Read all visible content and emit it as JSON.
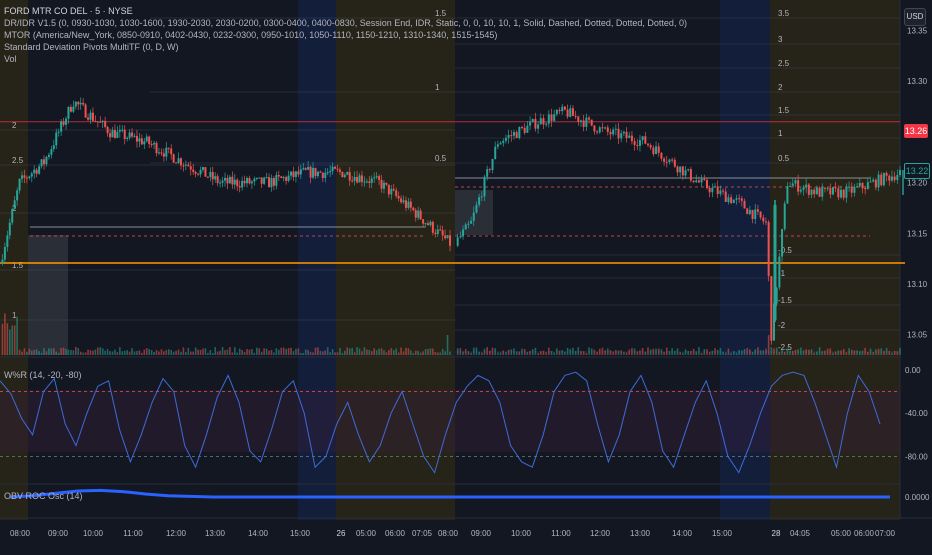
{
  "header": {
    "symbol": "FORD MTR CO DEL · 5 · NYSE",
    "indicators": [
      "DR/IDR V1.5 (0, 0930-1030, 1030-1600, 1930-2030, 2030-0200, 0300-0400, 0400-0830, Session End, IDR, Static, 0, 0, 10, 10, 1, Solid, Dashed, Dotted, Dotted, Dotted, 0)",
      "MTOR (America/New_York, 0850-0910, 0402-0430, 0232-0300, 0950-1010, 1050-1110, 1150-1210, 1310-1340, 1515-1545)",
      "Standard Deviation Pivots MultiTF (0, D, W)",
      "Vol"
    ],
    "currency": "USD"
  },
  "colors": {
    "background": "#131722",
    "up": "#26a69a",
    "down": "#ef5350",
    "orange_line": "#ff9800",
    "red_level": "#f23645",
    "wr_line": "#3f6bd8",
    "obv_line": "#2962ff"
  },
  "chart_data": [
    {
      "type": "candlestick",
      "title": "FORD MTR CO DEL · 5 · NYSE",
      "ylim": [
        13.03,
        13.38
      ],
      "price_ticks": [
        "13.35",
        "13.30",
        "13.25",
        "13.20",
        "13.15",
        "13.10",
        "13.05"
      ],
      "last_price_label": "13.26",
      "current_price_label": "13.22",
      "red_level": 13.26,
      "orange_level": 13.125,
      "std_levels_left": [
        "2",
        "2.5",
        "2",
        "1.5",
        "1"
      ],
      "std_levels_mid": [
        "1.5",
        "1",
        "0.5"
      ],
      "std_levels_right": [
        "3.5",
        "3",
        "2.5",
        "2",
        "1.5",
        "1",
        "0.5",
        "-0.5",
        "-1",
        "-1.5",
        "-2",
        "-2.5"
      ],
      "time_labels": [
        "08:00",
        "09:00",
        "10:00",
        "11:00",
        "12:00",
        "13:00",
        "14:00",
        "15:00",
        "26",
        "05:00",
        "06:00",
        "07:05",
        "08:00",
        "09:00",
        "10:00",
        "11:00",
        "12:00",
        "13:00",
        "14:00",
        "15:00",
        "28",
        "04:05",
        "05:00",
        "06:00",
        "07:00"
      ],
      "path": [
        [
          0,
          13.12
        ],
        [
          8,
          13.2
        ],
        [
          18,
          13.22
        ],
        [
          30,
          13.28
        ],
        [
          45,
          13.25
        ],
        [
          60,
          13.24
        ],
        [
          75,
          13.22
        ],
        [
          90,
          13.2
        ],
        [
          110,
          13.2
        ],
        [
          125,
          13.21
        ],
        [
          140,
          13.21
        ],
        [
          155,
          13.2
        ],
        [
          170,
          13.17
        ],
        [
          184,
          13.14
        ],
        [
          190,
          13.16
        ],
        [
          200,
          13.24
        ],
        [
          215,
          13.26
        ],
        [
          225,
          13.27
        ],
        [
          240,
          13.25
        ],
        [
          255,
          13.24
        ],
        [
          265,
          13.22
        ],
        [
          275,
          13.2
        ],
        [
          290,
          13.18
        ],
        [
          300,
          13.16
        ],
        [
          302,
          13.05
        ],
        [
          308,
          13.2
        ],
        [
          320,
          13.19
        ],
        [
          330,
          13.19
        ],
        [
          340,
          13.2
        ],
        [
          350,
          13.21
        ]
      ],
      "volume_note": "Vol"
    },
    {
      "type": "line",
      "title": "W%R (14, -20, -80)",
      "ylim": [
        -100,
        0
      ],
      "ticks": [
        "0.00",
        "-40.00",
        "-80.00"
      ],
      "bands": [
        -20,
        -80
      ],
      "values": [
        -10,
        -22,
        -45,
        -60,
        -20,
        -8,
        -50,
        -70,
        -40,
        -15,
        -10,
        -55,
        -85,
        -60,
        -30,
        -8,
        -20,
        -70,
        -90,
        -60,
        -25,
        -5,
        -30,
        -75,
        -85,
        -55,
        -20,
        -10,
        -40,
        -90,
        -80,
        -50,
        -30,
        -60,
        -85,
        -70,
        -40,
        -20,
        -50,
        -80,
        -95,
        -60,
        -30,
        -15,
        -5,
        -10,
        -30,
        -70,
        -85,
        -90,
        -60,
        -20,
        -5,
        -2,
        -10,
        -50,
        -85,
        -60,
        -20,
        -5,
        -30,
        -75,
        -90,
        -60,
        -30,
        -10,
        -40,
        -80,
        -95,
        -70,
        -40,
        -15,
        -5,
        -2,
        -5,
        -30,
        -60,
        -90,
        -40,
        -5,
        -20,
        -50
      ]
    },
    {
      "type": "line",
      "title": "OBV ROC Osc (14)",
      "ticks": [
        "0.0000"
      ],
      "values": [
        0,
        0.2,
        0.6,
        1.0,
        1.1,
        0.9,
        0.5,
        0.2,
        0.1,
        0,
        0,
        0,
        0,
        0,
        0,
        0,
        0,
        0,
        0,
        0,
        0,
        0,
        0,
        0,
        0,
        0,
        0,
        0,
        0,
        0,
        0,
        0,
        0,
        0,
        0,
        0,
        0,
        0,
        0,
        0
      ]
    }
  ]
}
